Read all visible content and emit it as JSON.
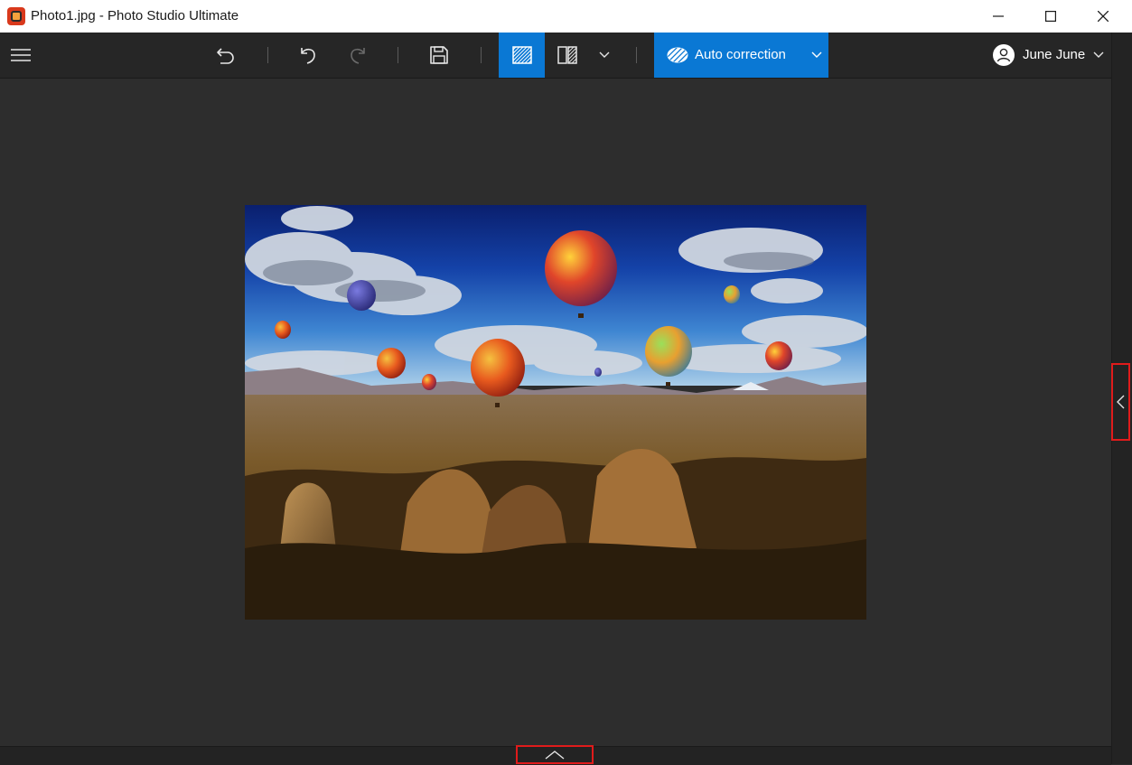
{
  "window": {
    "title": "Photo1.jpg - Photo Studio Ultimate"
  },
  "toolbar": {
    "auto_correction_label": "Auto correction"
  },
  "user": {
    "name": "June June"
  },
  "icons": {
    "menu": "hamburger-menu-icon",
    "revert": "revert-icon",
    "undo": "undo-icon",
    "redo": "redo-icon",
    "save": "save-icon",
    "single_view": "single-view-icon",
    "compare_view": "compare-view-icon"
  },
  "colors": {
    "accent": "#0a78d4",
    "highlight_border": "#e01b1b",
    "background": "#2d2d2d",
    "toolbar": "#262626"
  }
}
